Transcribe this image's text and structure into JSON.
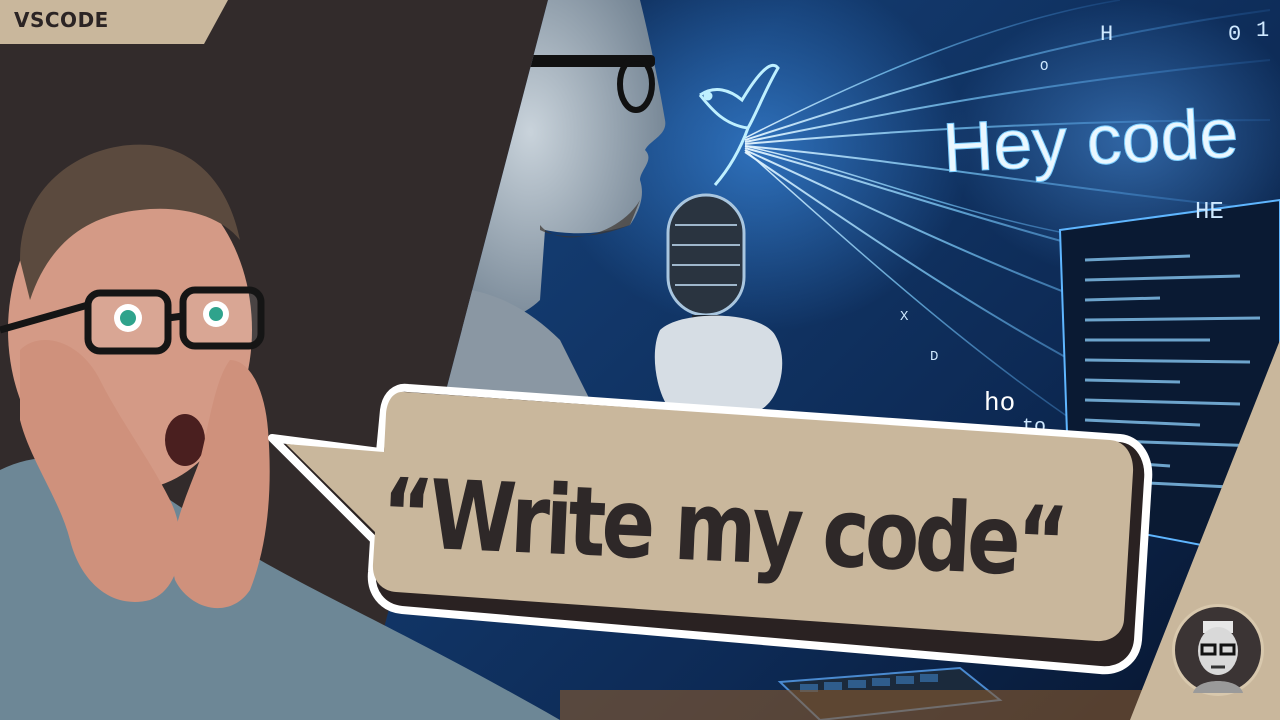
{
  "tag": {
    "label": "VSCODE"
  },
  "illustration": {
    "screen_heading": "Hey code",
    "floating_text": [
      "H",
      "HE",
      "ho",
      "to",
      "0",
      "1",
      "D",
      "X",
      "O"
    ]
  },
  "bubble": {
    "quote": "“Write my code“"
  },
  "colors": {
    "background": "#322b2b",
    "accent_beige": "#c9b79c",
    "text_dark": "#2e2828",
    "glow_blue": "#7fd0ff"
  },
  "icons": [
    "bird-icon",
    "microphone-icon",
    "avatar-badge"
  ]
}
